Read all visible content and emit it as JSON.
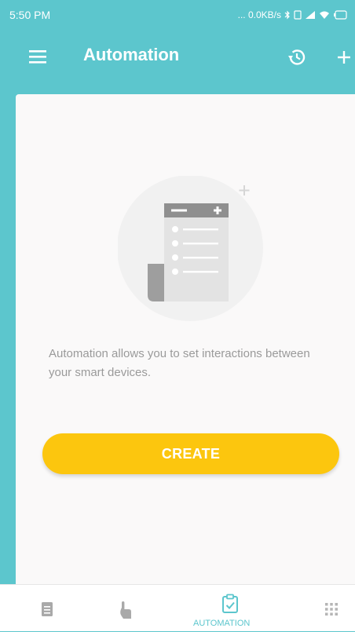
{
  "status_bar": {
    "time": "5:50 PM",
    "network_speed": "... 0.0KB/s"
  },
  "app_bar": {
    "title": "Automation",
    "menu_icon": "menu-icon",
    "history_icon": "history-icon",
    "add_icon": "plus-icon"
  },
  "empty_state": {
    "description": "Automation allows you to set interactions between your smart devices.",
    "create_label": "CREATE"
  },
  "bottom_nav": {
    "items": [
      {
        "icon": "list-icon",
        "label": "",
        "active": false
      },
      {
        "icon": "touch-icon",
        "label": "",
        "active": false
      },
      {
        "icon": "clipboard-check-icon",
        "label": "AUTOMATION",
        "active": true
      },
      {
        "icon": "grid-icon",
        "label": "",
        "active": false
      }
    ]
  },
  "colors": {
    "primary": "#5cc6cd",
    "accent": "#fcc60e",
    "card_bg": "#faf9f9",
    "description_text": "#9a9a9a"
  }
}
